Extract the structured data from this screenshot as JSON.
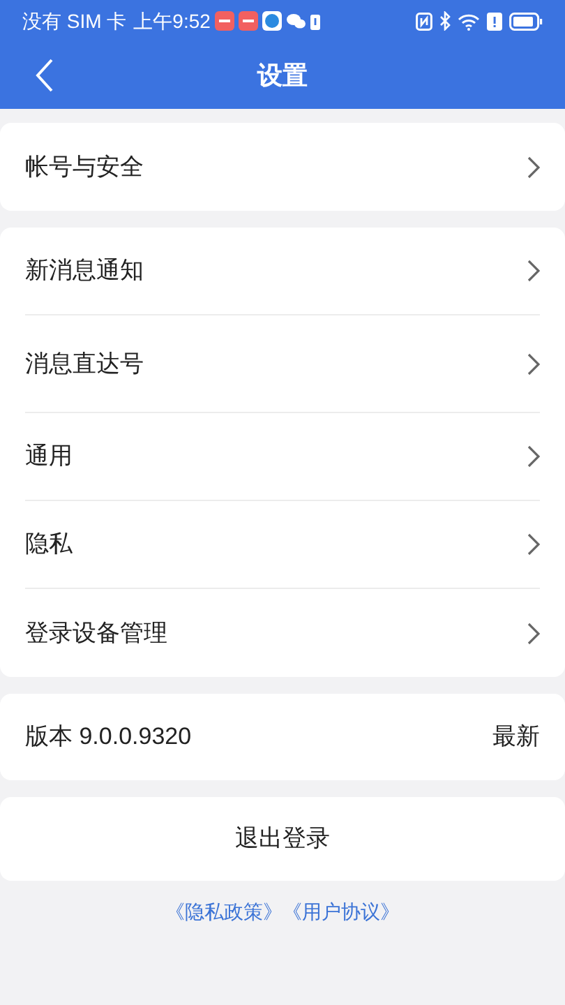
{
  "status_bar": {
    "carrier": "没有 SIM 卡",
    "time": "上午9:52"
  },
  "nav": {
    "title": "设置"
  },
  "groups": [
    {
      "items": [
        {
          "label": "帐号与安全"
        }
      ]
    },
    {
      "items": [
        {
          "label": "新消息通知"
        },
        {
          "label": "消息直达号"
        },
        {
          "label": "通用"
        },
        {
          "label": "隐私"
        },
        {
          "label": "登录设备管理"
        }
      ]
    }
  ],
  "version": {
    "label": "版本 9.0.0.9320",
    "value": "最新"
  },
  "logout": {
    "label": "退出登录"
  },
  "links": [
    "《隐私政策》",
    "《用户协议》"
  ]
}
